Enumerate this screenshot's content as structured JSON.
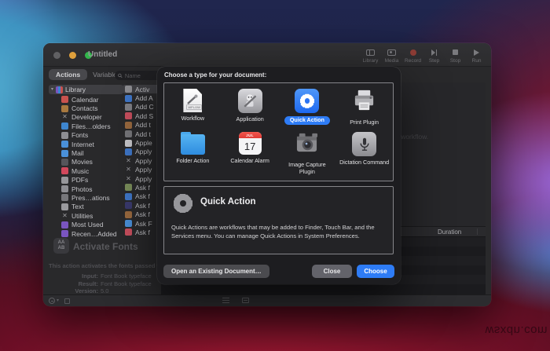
{
  "desktop": {
    "watermark": "wsxdn.com"
  },
  "window": {
    "title": "Untitled",
    "toolbar": [
      "Library",
      "Media",
      "Record",
      "Step",
      "Stop",
      "Run"
    ],
    "tabs": [
      "Actions",
      "Variables"
    ],
    "search_placeholder": "Name",
    "sidebar": {
      "root": "Library",
      "items": [
        {
          "label": "Calendar",
          "color": "#c9524e"
        },
        {
          "label": "Contacts",
          "color": "#a8793f"
        },
        {
          "label": "Developer",
          "glyph": "✕"
        },
        {
          "label": "Files…olders",
          "color": "#3e86cf"
        },
        {
          "label": "Fonts",
          "color": "#8e8e93"
        },
        {
          "label": "Internet",
          "color": "#4a90d9"
        },
        {
          "label": "Mail",
          "color": "#4a90d9"
        },
        {
          "label": "Movies",
          "color": "#55555a"
        },
        {
          "label": "Music",
          "color": "#d2485c"
        },
        {
          "label": "PDFs",
          "color": "#97979b"
        },
        {
          "label": "Photos",
          "color": "#8e8e93"
        },
        {
          "label": "Pres…ations",
          "color": "#77777b"
        },
        {
          "label": "Text",
          "color": "#9a9a9e"
        },
        {
          "label": "Utilities",
          "glyph": "✕"
        },
        {
          "label": "Most Used",
          "color": "#7a55c0"
        },
        {
          "label": "Recen…Added",
          "color": "#7a55c0"
        }
      ]
    },
    "actions": [
      {
        "label": "Activ",
        "color": "#8e8e93",
        "selected": true
      },
      {
        "label": "Add A",
        "color": "#3f77c9"
      },
      {
        "label": "Add C",
        "color": "#808086"
      },
      {
        "label": "Add S",
        "color": "#c94f5e"
      },
      {
        "label": "Add t",
        "color": "#9a6a3f"
      },
      {
        "label": "Add t",
        "color": "#77777b"
      },
      {
        "label": "Apple",
        "color": "#c8c8cc"
      },
      {
        "label": "Apply",
        "color": "#3f77c9"
      },
      {
        "label": "Apply",
        "glyph": "✕"
      },
      {
        "label": "Apply",
        "glyph": "✕"
      },
      {
        "label": "Apply",
        "glyph": "✕"
      },
      {
        "label": "Ask f",
        "color": "#7a8e5a"
      },
      {
        "label": "Ask f",
        "color": "#3f77c9"
      },
      {
        "label": "Ask f",
        "color": "#3a3a6e"
      },
      {
        "label": "Ask f",
        "color": "#9a6a3f"
      },
      {
        "label": "Ask F",
        "color": "#4a90d9"
      },
      {
        "label": "Ask f",
        "color": "#c94f5e"
      },
      {
        "label": "Ask f",
        "color": "#97979b"
      }
    ],
    "canvas_hint": "r workflow.",
    "log_header": "Duration",
    "info_panel": {
      "title": "Activate Fonts",
      "description": "This action activates the fonts passed fro",
      "fields": [
        {
          "label": "Input:",
          "value": "Font Book typeface"
        },
        {
          "label": "Result:",
          "value": "Font Book typeface"
        },
        {
          "label": "Version:",
          "value": "5.0"
        }
      ]
    }
  },
  "dialog": {
    "title": "Choose a type for your document:",
    "types": [
      {
        "label": "Workflow",
        "badge": "WFLOW"
      },
      {
        "label": "Application"
      },
      {
        "label": "Quick Action",
        "selected": true
      },
      {
        "label": "Print Plugin"
      },
      {
        "label": "Folder Action"
      },
      {
        "label": "Calendar Alarm",
        "month": "JUL",
        "day": "17"
      },
      {
        "label": "Image Capture Plugin"
      },
      {
        "label": "Dictation Command"
      }
    ],
    "detail": {
      "title": "Quick Action",
      "description": "Quick Actions are workflows that may be added to Finder, Touch Bar, and the Services menu. You can manage Quick Actions in System Preferences."
    },
    "buttons": {
      "open": "Open an Existing Document…",
      "close": "Close",
      "choose": "Choose"
    },
    "accent": "#2e7cf6"
  }
}
